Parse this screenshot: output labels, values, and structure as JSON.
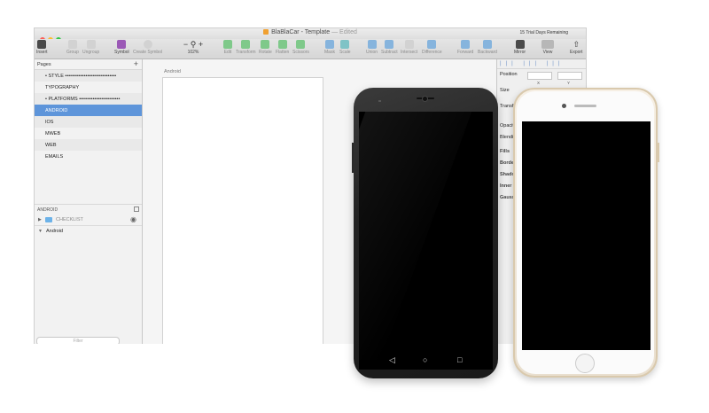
{
  "window": {
    "title": "BlaBlaCar - Template",
    "edited": "— Edited",
    "trial": "15 Trial Days Remaining"
  },
  "toolbar": {
    "insert": "Insert",
    "group": "Group",
    "ungroup": "Ungroup",
    "symbol": "Symbol",
    "create_symbol": "Create Symbol",
    "zoom_minus": "−",
    "zoom_plus": "+",
    "zoom_value": "102%",
    "edit": "Edit",
    "transform": "Transform",
    "rotate": "Rotate",
    "flatten": "Flatten",
    "scissors": "Scissors",
    "mask": "Mask",
    "scale": "Scale",
    "union": "Union",
    "subtract": "Subtract",
    "intersect": "Intersect",
    "difference": "Difference",
    "forward": "Forward",
    "backward": "Backward",
    "mirror": "Mirror",
    "view": "View",
    "export": "Export"
  },
  "pages": {
    "header": "Pages",
    "add": "+",
    "items": [
      {
        "label": "• STYLE ••••••••••••••••••••••••••••••"
      },
      {
        "label": "TYPOGRAPHY"
      },
      {
        "label": "• PLATFORMS ••••••••••••••••••••••••"
      },
      {
        "label": "ANDROID"
      },
      {
        "label": "IOS"
      },
      {
        "label": "MWEB"
      },
      {
        "label": "WEB"
      },
      {
        "label": "EMAILS"
      }
    ]
  },
  "layers": {
    "header": "ANDROID",
    "items": [
      {
        "label": "CHECKLIST"
      },
      {
        "label": "Android"
      }
    ],
    "filter_placeholder": "Filter"
  },
  "canvas": {
    "artboard_label": "Android"
  },
  "inspector": {
    "position": "Position",
    "x": "X",
    "y": "Y",
    "size": "Size",
    "transform": "Transform",
    "opacity": "Opacity",
    "blending": "Blending",
    "fills": "Fills",
    "borders": "Borders",
    "shadows": "Shadows",
    "inner_shadows": "Inner Shadows",
    "gaussian": "Gaussian Blur"
  }
}
